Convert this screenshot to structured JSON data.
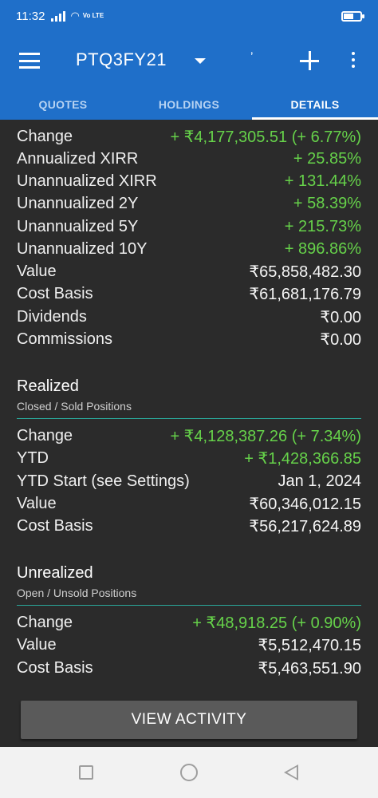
{
  "status_bar": {
    "time": "11:32",
    "network": "Vo LTE"
  },
  "app_bar": {
    "title": "PTQ3FY21",
    "tick_glyph": "ʼ",
    "icons": [
      "menu-icon",
      "dropdown-icon",
      "add-icon",
      "more-icon"
    ]
  },
  "tabs": [
    {
      "label": "QUOTES",
      "active": false
    },
    {
      "label": "HOLDINGS",
      "active": false
    },
    {
      "label": "DETAILS",
      "active": true
    }
  ],
  "summary": {
    "rows": [
      {
        "label": "Change",
        "value": "+ ₹4,177,305.51 (+ 6.77%)",
        "positive": true
      },
      {
        "label": "Annualized XIRR",
        "value": "+ 25.85%",
        "positive": true
      },
      {
        "label": "Unannualized XIRR",
        "value": "+ 131.44%",
        "positive": true
      },
      {
        "label": "Unannualized 2Y",
        "value": "+ 58.39%",
        "positive": true
      },
      {
        "label": "Unannualized 5Y",
        "value": "+ 215.73%",
        "positive": true
      },
      {
        "label": "Unannualized 10Y",
        "value": "+ 896.86%",
        "positive": true
      },
      {
        "label": "Value",
        "value": "₹65,858,482.30",
        "positive": false
      },
      {
        "label": "Cost Basis",
        "value": "₹61,681,176.79",
        "positive": false
      },
      {
        "label": "Dividends",
        "value": "₹0.00",
        "positive": false
      },
      {
        "label": "Commissions",
        "value": "₹0.00",
        "positive": false
      }
    ]
  },
  "realized": {
    "title": "Realized",
    "subtitle": "Closed / Sold Positions",
    "rows": [
      {
        "label": "Change",
        "value": "+ ₹4,128,387.26 (+ 7.34%)",
        "positive": true
      },
      {
        "label": "YTD",
        "value": "+ ₹1,428,366.85",
        "positive": true
      },
      {
        "label": "YTD Start (see Settings)",
        "value": "Jan 1, 2024",
        "positive": false
      },
      {
        "label": "Value",
        "value": "₹60,346,012.15",
        "positive": false
      },
      {
        "label": "Cost Basis",
        "value": "₹56,217,624.89",
        "positive": false
      }
    ]
  },
  "unrealized": {
    "title": "Unrealized",
    "subtitle": "Open / Unsold Positions",
    "rows": [
      {
        "label": "Change",
        "value": "+ ₹48,918.25 (+ 0.90%)",
        "positive": true
      },
      {
        "label": "Value",
        "value": "₹5,512,470.15",
        "positive": false
      },
      {
        "label": "Cost Basis",
        "value": "₹5,463,551.90",
        "positive": false
      }
    ]
  },
  "view_activity_label": "VIEW ACTIVITY",
  "colors": {
    "primary": "#1f6fc9",
    "background": "#2b2b2b",
    "positive": "#66d24a",
    "divider": "#2aa89a"
  }
}
